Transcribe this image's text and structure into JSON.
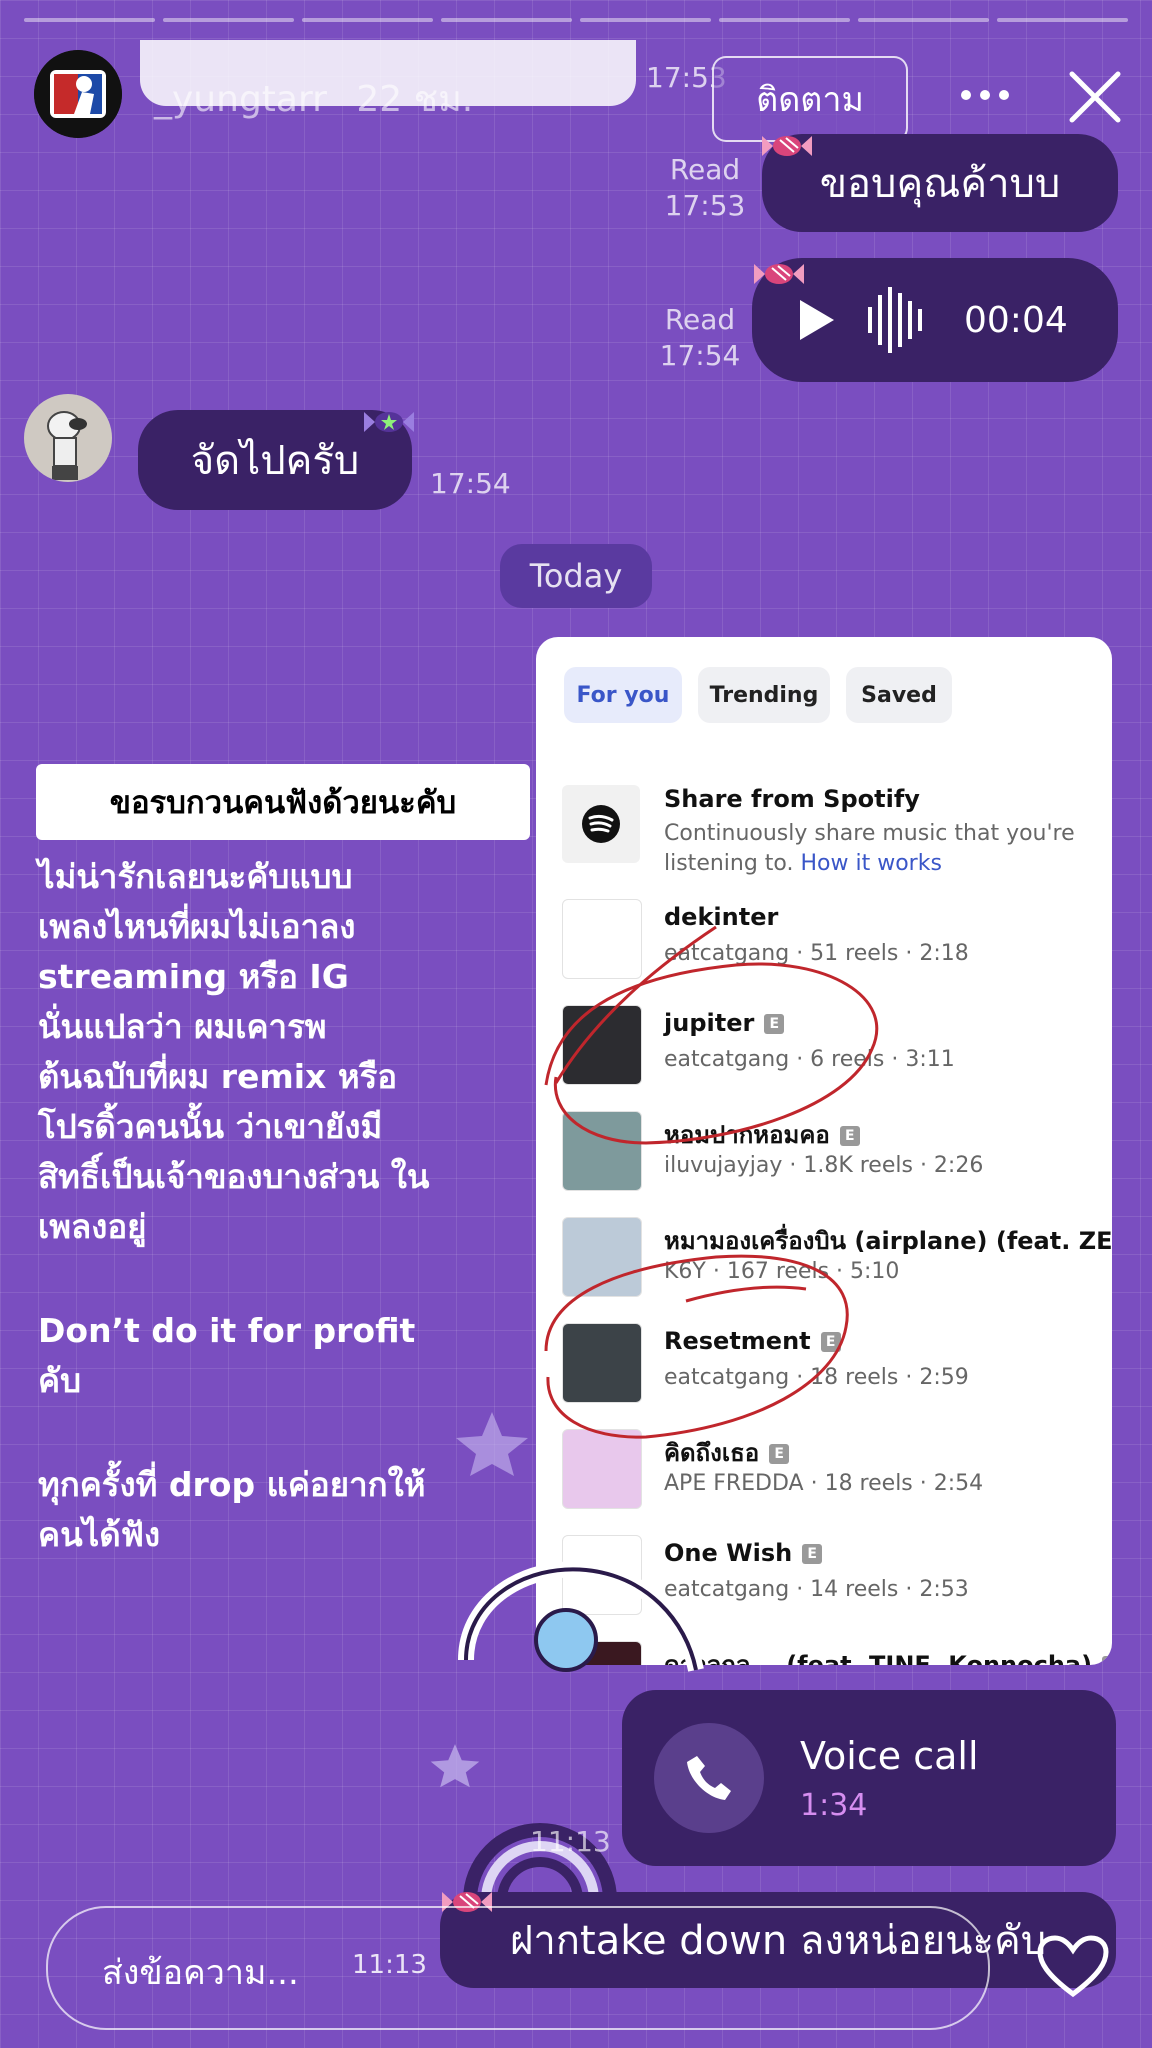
{
  "story": {
    "username": "_yungtarr",
    "time_ago": "22 ชม.",
    "follow_label": "ติดตาม",
    "segments": 8
  },
  "chat": {
    "top_time": "17:53",
    "msg_thanks": {
      "text": "ขอบคุณค้าบบ",
      "status": "Read",
      "time": "17:53"
    },
    "msg_voice": {
      "duration": "00:04",
      "status": "Read",
      "time": "17:54"
    },
    "msg_reply": {
      "text": "จัดไปครับ",
      "time": "17:54"
    },
    "day_label": "Today",
    "voice_call": {
      "label": "Voice call",
      "duration": "1:34",
      "time": "11:13"
    },
    "msg_takedown": {
      "text": "ฝากtake down ลงหน่อยนะคับ"
    }
  },
  "music_picker": {
    "tabs": [
      "For you",
      "Trending",
      "Saved"
    ],
    "spotify": {
      "title": "Share from Spotify",
      "desc_line1": "Continuously share music that you're",
      "desc_line2": "listening to.",
      "link": "How it works"
    },
    "songs": [
      {
        "title": "dekinter",
        "meta": "eatcatgang · 51 reels · 2:18",
        "explicit": false
      },
      {
        "title": "jupiter",
        "meta": "eatcatgang · 6 reels · 3:11",
        "explicit": true
      },
      {
        "title": "หอมปากหอมคอ",
        "meta": "iluvujayjay · 1.8K reels · 2:26",
        "explicit": true
      },
      {
        "title": "หมามองเครื่องบิน (airplane) (feat. ZEN...",
        "meta": "K6Y · 167 reels · 5:10",
        "explicit": false
      },
      {
        "title": "Resetment",
        "meta": "eatcatgang · 18 reels · 2:59",
        "explicit": true
      },
      {
        "title": "คิดถึงเธอ",
        "meta": "APE FREDDA · 18 reels · 2:54",
        "explicit": true
      },
      {
        "title": "One Wish",
        "meta": "eatcatgang · 14 reels · 2:53",
        "explicit": true
      },
      {
        "title": "ดาวลูกลู... (feat. TINE, Konnocha)",
        "meta": "",
        "explicit": true
      }
    ],
    "explicit_badge": "E"
  },
  "overlay": {
    "caption": "ขอรบกวนคนฟังด้วยนะคับ",
    "lines": [
      "ไม่น่ารักเลยนะคับแบบ",
      "เพลงไหนที่ผมไม่เอาลง",
      "streaming หรือ IG",
      "นั่นแปลว่า ผมเคารพ",
      "ต้นฉบับที่ผม remix หรือ",
      "โปรดิ้วคนนั้น ว่าเขายังมี",
      "สิทธิ์เป็นเจ้าของบางส่วน ใน",
      "เพลงอยู่",
      "Don’t do it for profit",
      "คับ",
      "ทุกครั้งที่ drop แค่อยากให้",
      "คนได้ฟัง"
    ]
  },
  "reply_bar": {
    "placeholder": "ส่งข้อความ...",
    "time": "11:13"
  },
  "colors": {
    "background": "#7a4ec0",
    "bubble": "#3a2266",
    "link": "#3a56c8",
    "annotation": "#c0262c"
  }
}
